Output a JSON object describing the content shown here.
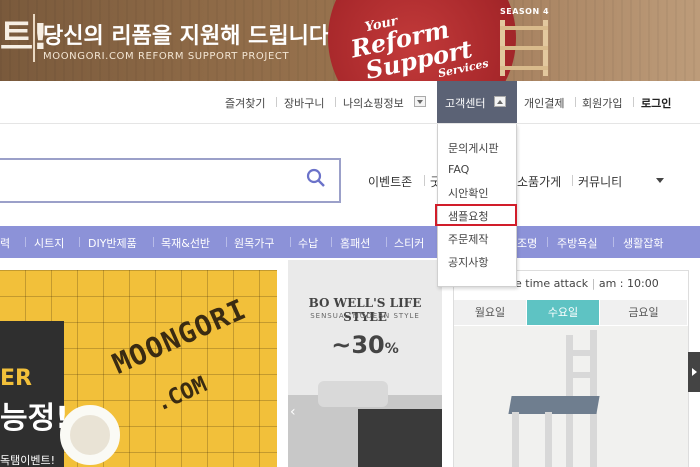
{
  "banner": {
    "mark": "트!",
    "title": "당신의 리폼을 지원해 드립니다!",
    "subtitle": "MOONGORI.COM REFORM SUPPORT PROJECT",
    "script_line1": "Your",
    "script_line2": "Reform",
    "script_line3": "Support",
    "script_line4": "Services",
    "season": "SEASON 4"
  },
  "util_nav": {
    "favorites": "즐겨찾기",
    "cart": "장바구니",
    "my_shopping": "나의쇼핑정보",
    "customer_center": "고객센터",
    "personal_payment": "개인결제",
    "signup": "회원가입",
    "login": "로그인"
  },
  "customer_center_menu": [
    "문의게시판",
    "FAQ",
    "시안확인",
    "샘플요청",
    "주문제작",
    "공지사항"
  ],
  "search": {
    "placeholder": ""
  },
  "sub_nav": {
    "event_zone": "이벤트존",
    "partial1": "굿",
    "small_shop": "소품가게",
    "community": "커뮤니티"
  },
  "categories": [
    "력",
    "시트지",
    "DIY반제품",
    "목재&선반",
    "원목가구",
    "수납",
    "홈패션",
    "스티커",
    "조명",
    "주방욕실",
    "생활잡화"
  ],
  "hero": {
    "badge1": "ER",
    "badge2": "능정!",
    "badge3": "독탬이벤트!",
    "logo1": "MOONGORI",
    "logo2": ".COM"
  },
  "promo": {
    "title": "BO WELL'S LIFE STYLE",
    "subtitle": "SENSUAL MODERN STYLE",
    "discount": "~30",
    "discount_unit": "%",
    "prev_icon": "‹"
  },
  "time_attack": {
    "heading": "e time attack",
    "time": "am : 10:00",
    "tabs": [
      "월요일",
      "수요일",
      "금요일"
    ],
    "active_tab": "수요일"
  },
  "colors": {
    "category_bar": "#8c92d8",
    "active_tab": "#5ec3c3",
    "highlight": "#d11d2a",
    "customer_center_bg": "#5b6275"
  }
}
